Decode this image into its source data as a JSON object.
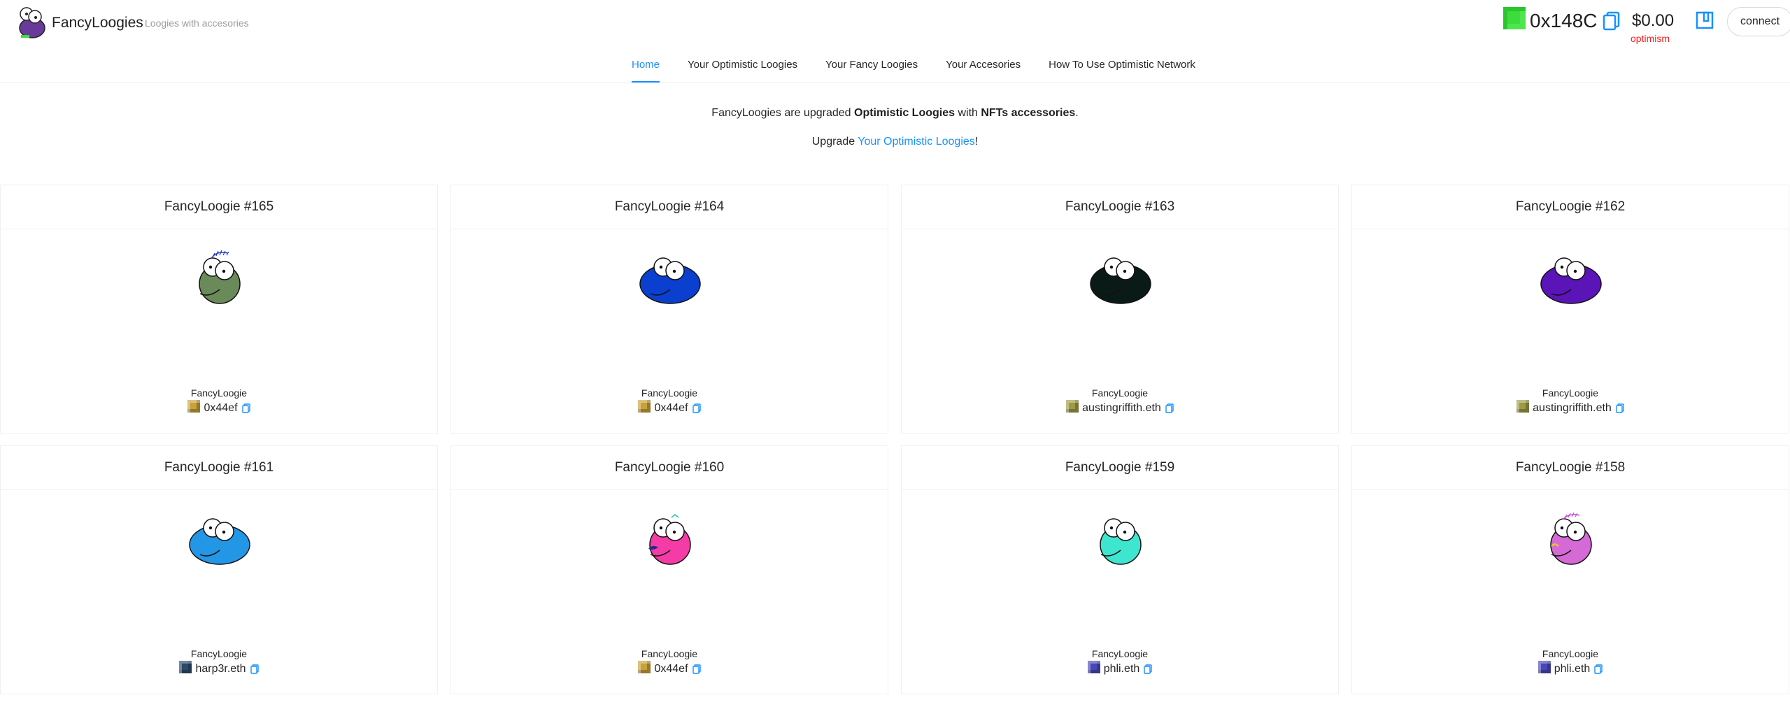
{
  "header": {
    "title": "FancyLoogies",
    "subtitle": "Loogies with accesories",
    "address": "0x148C",
    "balance": "$0.00",
    "network": "optimism",
    "connect_label": "connect"
  },
  "nav": {
    "tabs": [
      {
        "label": "Home",
        "active": true
      },
      {
        "label": "Your Optimistic Loogies",
        "active": false
      },
      {
        "label": "Your Fancy Loogies",
        "active": false
      },
      {
        "label": "Your Accesories",
        "active": false
      },
      {
        "label": "How To Use Optimistic Network",
        "active": false
      }
    ]
  },
  "intro": {
    "p1_a": "FancyLoogies are upgraded ",
    "p1_b": "Optimistic Loogies",
    "p1_c": " with ",
    "p1_d": "NFTs accessories",
    "p1_e": ".",
    "p2_a": "Upgrade ",
    "p2_link": "Your Optimistic Loogies",
    "p2_b": "!"
  },
  "cards": [
    {
      "title": "FancyLoogie #165",
      "name": "FancyLoogie",
      "owner": "0x44ef",
      "color": "#6b8a5a",
      "shape": "round",
      "accessory": "hair-blue",
      "blockie": "#c9a13a"
    },
    {
      "title": "FancyLoogie #164",
      "name": "FancyLoogie",
      "owner": "0x44ef",
      "color": "#0a3fcf",
      "shape": "wide",
      "accessory": "none",
      "blockie": "#c9a13a"
    },
    {
      "title": "FancyLoogie #163",
      "name": "FancyLoogie",
      "owner": "austingriffith.eth",
      "color": "#0a1a16",
      "shape": "wide",
      "accessory": "none",
      "blockie": "#9c9b45"
    },
    {
      "title": "FancyLoogie #162",
      "name": "FancyLoogie",
      "owner": "austingriffith.eth",
      "color": "#5a14b8",
      "shape": "wide",
      "accessory": "none",
      "blockie": "#9c9b45"
    },
    {
      "title": "FancyLoogie #161",
      "name": "FancyLoogie",
      "owner": "harp3r.eth",
      "color": "#2496e6",
      "shape": "wide",
      "accessory": "none",
      "blockie": "#2a4a6a"
    },
    {
      "title": "FancyLoogie #160",
      "name": "FancyLoogie",
      "owner": "0x44ef",
      "color": "#f53ca6",
      "shape": "round",
      "accessory": "mustache",
      "blockie": "#c9a13a"
    },
    {
      "title": "FancyLoogie #159",
      "name": "FancyLoogie",
      "owner": "phli.eth",
      "color": "#3ee6cf",
      "shape": "round",
      "accessory": "none",
      "blockie": "#4848b8"
    },
    {
      "title": "FancyLoogie #158",
      "name": "FancyLoogie",
      "owner": "phli.eth",
      "color": "#d569d6",
      "shape": "round",
      "accessory": "hair-pink",
      "blockie": "#4848b8"
    }
  ],
  "colors": {
    "accent": "#1890ff",
    "network": "#ff1f1f"
  }
}
